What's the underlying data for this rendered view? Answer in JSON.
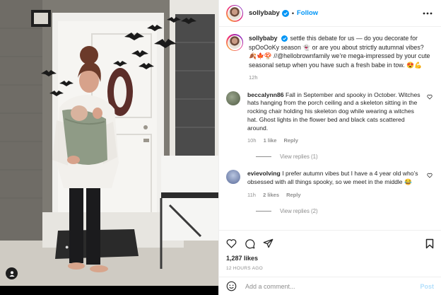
{
  "post": {
    "username": "sollybaby",
    "follow_label": "Follow",
    "dot": "•",
    "more_icon": "more-horizontal-icon",
    "verified_color": "#0095f6"
  },
  "caption": {
    "username": "sollybaby",
    "text": "settle this debate for us — do you decorate for spOoOoKy season 👻 or are you about strictly autumnal vibes? 🍂🍁🍄 //@hellobrownfamily we’re mega-impressed by your cute seasonal setup when you have such a fresh babe in tow. 😍💪",
    "time": "12h"
  },
  "comments": [
    {
      "username": "beccalynn86",
      "text": "Fall in September and spooky in October. Witches hats hanging from the porch ceiling and a skeleton sitting in the rocking chair holding his skeleton dog while wearing a witches hat. Ghost lights in the flower bed and black cats scattered around.",
      "time": "10h",
      "likes": "1 like",
      "reply": "Reply",
      "view_replies": "View replies (1)"
    },
    {
      "username": "evievolving",
      "text": "I prefer autumn vibes but I have a 4 year old who’s obsessed with all things spooky, so we meet in the middle 😂",
      "time": "11h",
      "likes": "2 likes",
      "reply": "Reply",
      "view_replies": "View replies (2)"
    }
  ],
  "actions": {
    "likes_count": "1,287 likes",
    "time_ago": "12 HOURS AGO"
  },
  "add_comment": {
    "placeholder": "Add a comment...",
    "post_label": "Post"
  },
  "colors": {
    "accent": "#0095f6",
    "muted": "#8e8e8e",
    "text": "#262626",
    "post_disabled": "#b2dffc"
  }
}
